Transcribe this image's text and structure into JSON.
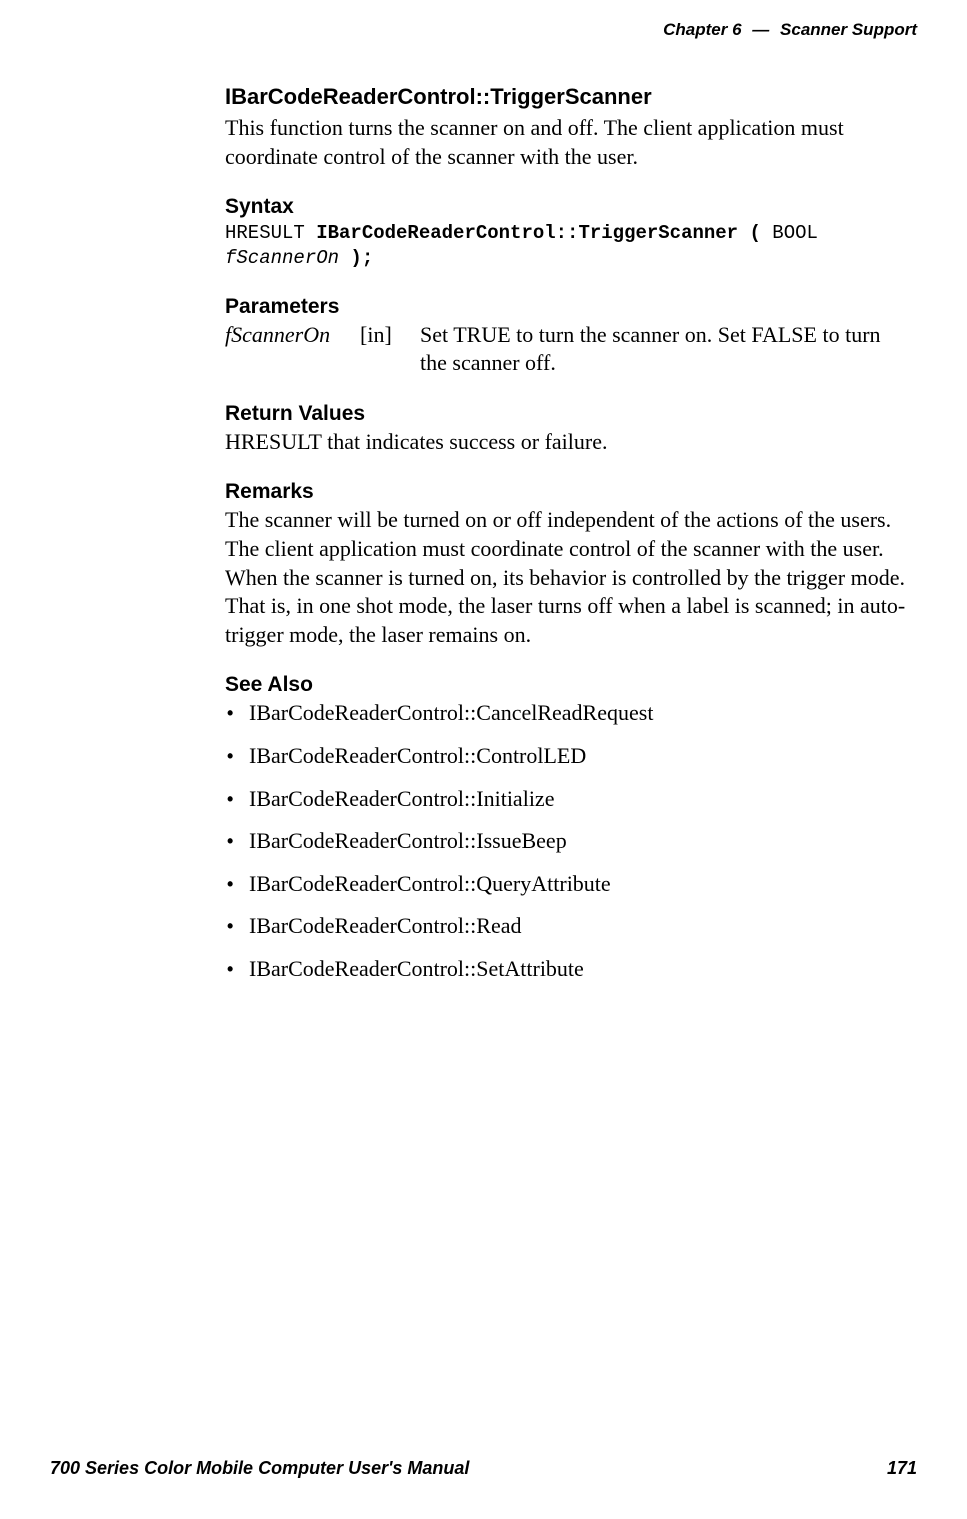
{
  "header": {
    "chapter": "Chapter  6",
    "dash": "—",
    "title": "Scanner Support"
  },
  "main": {
    "title": "IBarCodeReaderControl::TriggerScanner",
    "intro": "This function turns the scanner on and off. The client application must coordinate control of the scanner with the user.",
    "syntax": {
      "heading": "Syntax",
      "code_plain1": "HRESULT ",
      "code_bold1": "IBarCodeReaderControl::TriggerScanner ( ",
      "code_plain2": "BOOL",
      "code_italic": "fScannerOn",
      "code_bold2": " );"
    },
    "parameters": {
      "heading": "Parameters",
      "rows": [
        {
          "name": "fScannerOn",
          "dir": "[in]",
          "desc": "Set TRUE to turn the scanner on. Set FALSE to turn the scanner off."
        }
      ]
    },
    "return_values": {
      "heading": "Return Values",
      "text": "HRESULT that indicates success or failure."
    },
    "remarks": {
      "heading": "Remarks",
      "text": "The scanner will be turned on or off independent of the actions of the users. The client application must coordinate control of the scanner with the user. When the scanner is turned on, its behavior is controlled by the trigger mode. That is, in one shot mode, the laser turns off when a label is scanned; in auto-trigger mode, the laser remains on."
    },
    "see_also": {
      "heading": "See Also",
      "items": [
        "IBarCodeReaderControl::CancelReadRequest",
        "IBarCodeReaderControl::ControlLED",
        "IBarCodeReaderControl::Initialize",
        "IBarCodeReaderControl::IssueBeep",
        "IBarCodeReaderControl::QueryAttribute",
        "IBarCodeReaderControl::Read",
        "IBarCodeReaderControl::SetAttribute"
      ]
    }
  },
  "footer": {
    "left": "700 Series Color Mobile Computer User's Manual",
    "right": "171"
  }
}
